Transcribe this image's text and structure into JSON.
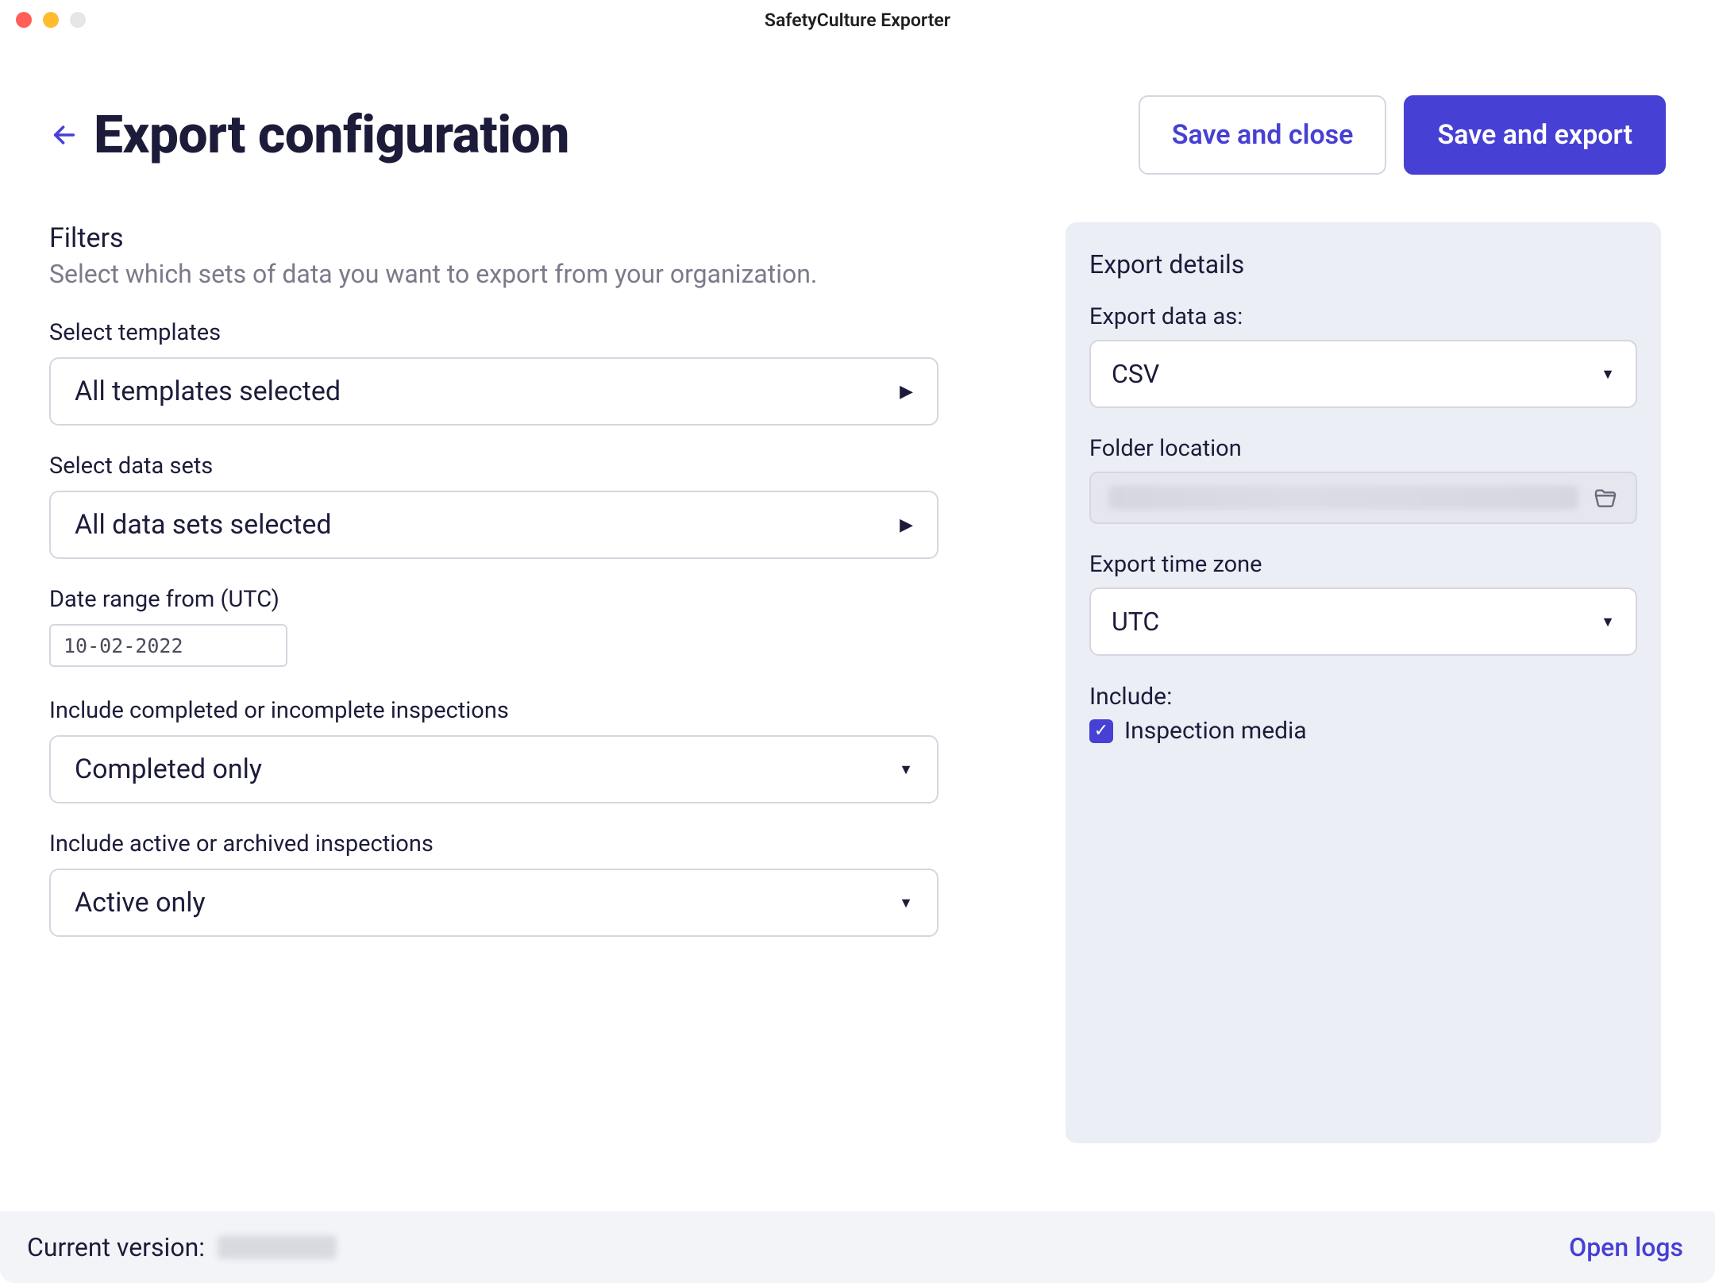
{
  "window": {
    "title": "SafetyCulture Exporter"
  },
  "header": {
    "title": "Export configuration",
    "save_close": "Save and close",
    "save_export": "Save and export"
  },
  "filters": {
    "title": "Filters",
    "description": "Select which sets of data you want to export from your organization.",
    "templates_label": "Select templates",
    "templates_value": "All templates selected",
    "datasets_label": "Select data sets",
    "datasets_value": "All data sets selected",
    "date_label": "Date range from (UTC)",
    "date_value": "10-02-2022",
    "completion_label": "Include completed or incomplete inspections",
    "completion_value": "Completed only",
    "archived_label": "Include active or archived inspections",
    "archived_value": "Active only"
  },
  "details": {
    "title": "Export details",
    "format_label": "Export data as:",
    "format_value": "CSV",
    "folder_label": "Folder location",
    "tz_label": "Export time zone",
    "tz_value": "UTC",
    "include_label": "Include:",
    "media_label": "Inspection media",
    "media_checked": true
  },
  "footer": {
    "version_label": "Current version:",
    "open_logs": "Open logs"
  },
  "colors": {
    "accent": "#4740d4"
  }
}
